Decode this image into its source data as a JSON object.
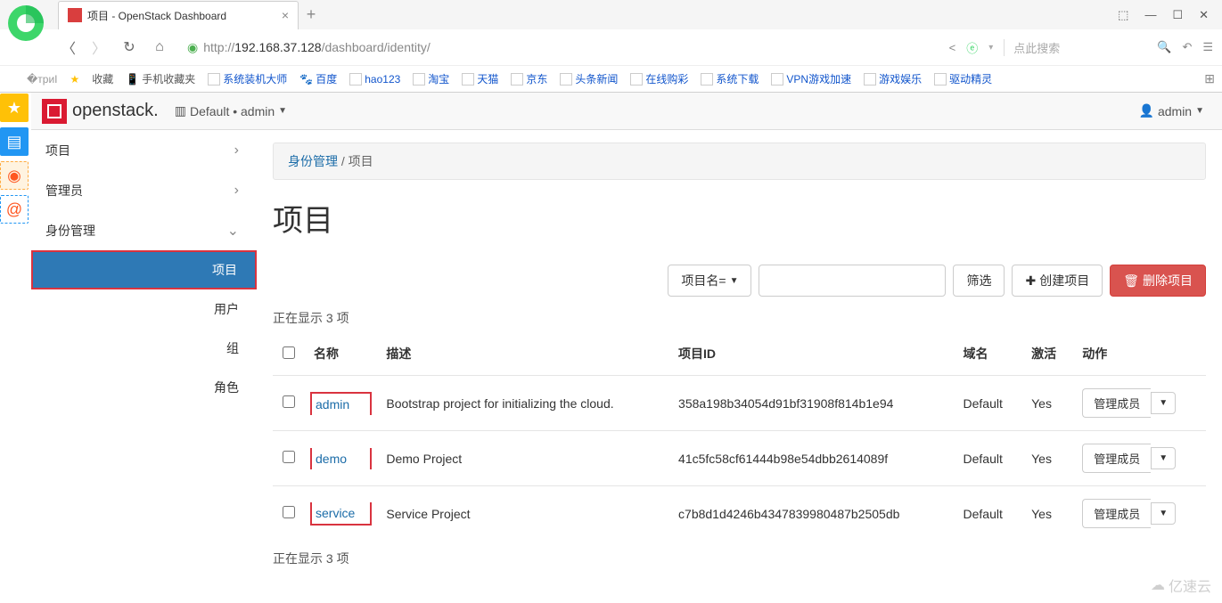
{
  "browser": {
    "tab_title": "项目 - OpenStack Dashboard",
    "url_prefix": "http://",
    "url_host": "192.168.37.128",
    "url_path": "/dashboard/identity/",
    "search_placeholder": "点此搜索",
    "bookmarks": {
      "fav": "收藏",
      "mobile": "手机收藏夹",
      "items": [
        "系统装机大师",
        "百度",
        "hao123",
        "淘宝",
        "天猫",
        "京东",
        "头条新闻",
        "在线购彩",
        "系统下载",
        "VPN游戏加速",
        "游戏娱乐",
        "驱动精灵"
      ]
    }
  },
  "header": {
    "brand": "openstack.",
    "domain_label": "Default • admin",
    "user": "admin"
  },
  "sidebar": {
    "groups": [
      {
        "label": "项目",
        "expanded": false
      },
      {
        "label": "管理员",
        "expanded": false
      },
      {
        "label": "身份管理",
        "expanded": true
      }
    ],
    "identity_items": [
      "项目",
      "用户",
      "组",
      "角色"
    ]
  },
  "breadcrumb": {
    "parent": "身份管理",
    "current": "项目"
  },
  "page": {
    "title": "项目"
  },
  "toolbar": {
    "filter_field": "项目名=",
    "filter_btn": "筛选",
    "create_btn": "创建项目",
    "delete_btn": "删除项目"
  },
  "table": {
    "count_text": "正在显示 3 项",
    "columns": [
      "名称",
      "描述",
      "项目ID",
      "域名",
      "激活",
      "动作"
    ],
    "action_label": "管理成员",
    "rows": [
      {
        "name": "admin",
        "desc": "Bootstrap project for initializing the cloud.",
        "id": "358a198b34054d91bf31908f814b1e94",
        "domain": "Default",
        "active": "Yes"
      },
      {
        "name": "demo",
        "desc": "Demo Project",
        "id": "41c5fc58cf61444b98e54dbb2614089f",
        "domain": "Default",
        "active": "Yes"
      },
      {
        "name": "service",
        "desc": "Service Project",
        "id": "c7b8d1d4246b4347839980487b2505db",
        "domain": "Default",
        "active": "Yes"
      }
    ]
  },
  "watermark": "亿速云"
}
